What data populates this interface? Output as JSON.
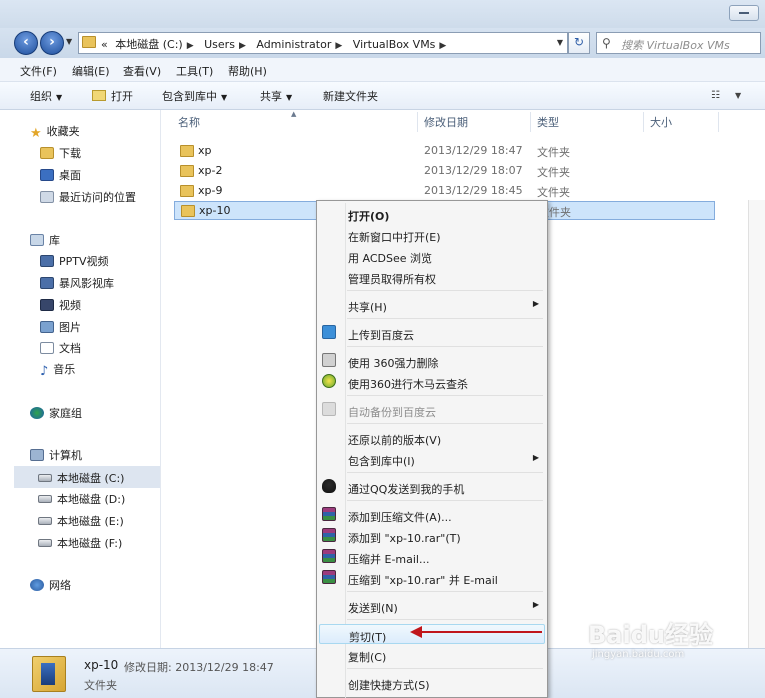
{
  "nav": {
    "crumbs": [
      "«",
      "本地磁盘 (C:)",
      "Users",
      "Administrator",
      "VirtualBox VMs"
    ],
    "search_placeholder": "搜索 VirtualBox VMs"
  },
  "menubar": [
    "文件(F)",
    "编辑(E)",
    "查看(V)",
    "工具(T)",
    "帮助(H)"
  ],
  "toolbar": {
    "organize": "组织",
    "open": "打开",
    "include": "包含到库中",
    "share": "共享",
    "new_folder": "新建文件夹"
  },
  "sidebar": {
    "favorites": {
      "label": "收藏夹",
      "items": [
        "下载",
        "桌面",
        "最近访问的位置"
      ]
    },
    "libraries": {
      "label": "库",
      "items": [
        "PPTV视频",
        "暴风影视库",
        "视频",
        "图片",
        "文档",
        "音乐"
      ]
    },
    "homegroup": "家庭组",
    "computer": {
      "label": "计算机",
      "items": [
        "本地磁盘 (C:)",
        "本地磁盘 (D:)",
        "本地磁盘 (E:)",
        "本地磁盘 (F:)"
      ]
    },
    "network": "网络"
  },
  "columns": [
    "名称",
    "修改日期",
    "类型",
    "大小"
  ],
  "files": [
    {
      "name": "xp",
      "date": "2013/12/29 18:47",
      "type": "文件夹"
    },
    {
      "name": "xp-2",
      "date": "2013/12/29 18:07",
      "type": "文件夹"
    },
    {
      "name": "xp-9",
      "date": "2013/12/29 18:45",
      "type": "文件夹"
    },
    {
      "name": "xp-10",
      "date": "",
      "type": "文件夹"
    }
  ],
  "context_menu": [
    "打开(O)",
    "在新窗口中打开(E)",
    "用 ACDSee 浏览",
    "管理员取得所有权",
    "共享(H)",
    "上传到百度云",
    "使用 360强力删除",
    "使用360进行木马云查杀",
    "自动备份到百度云",
    "还原以前的版本(V)",
    "包含到库中(I)",
    "通过QQ发送到我的手机",
    "添加到压缩文件(A)...",
    "添加到 \"xp-10.rar\"(T)",
    "压缩并 E-mail...",
    "压缩到 \"xp-10.rar\" 并 E-mail",
    "发送到(N)",
    "剪切(T)",
    "复制(C)",
    "创建快捷方式(S)"
  ],
  "details": {
    "name": "xp-10",
    "modified": "修改日期: 2013/12/29 18:47",
    "type": "文件夹"
  },
  "watermark": {
    "main": "Baidu经验",
    "sub": "jingyan.baidu.com"
  }
}
